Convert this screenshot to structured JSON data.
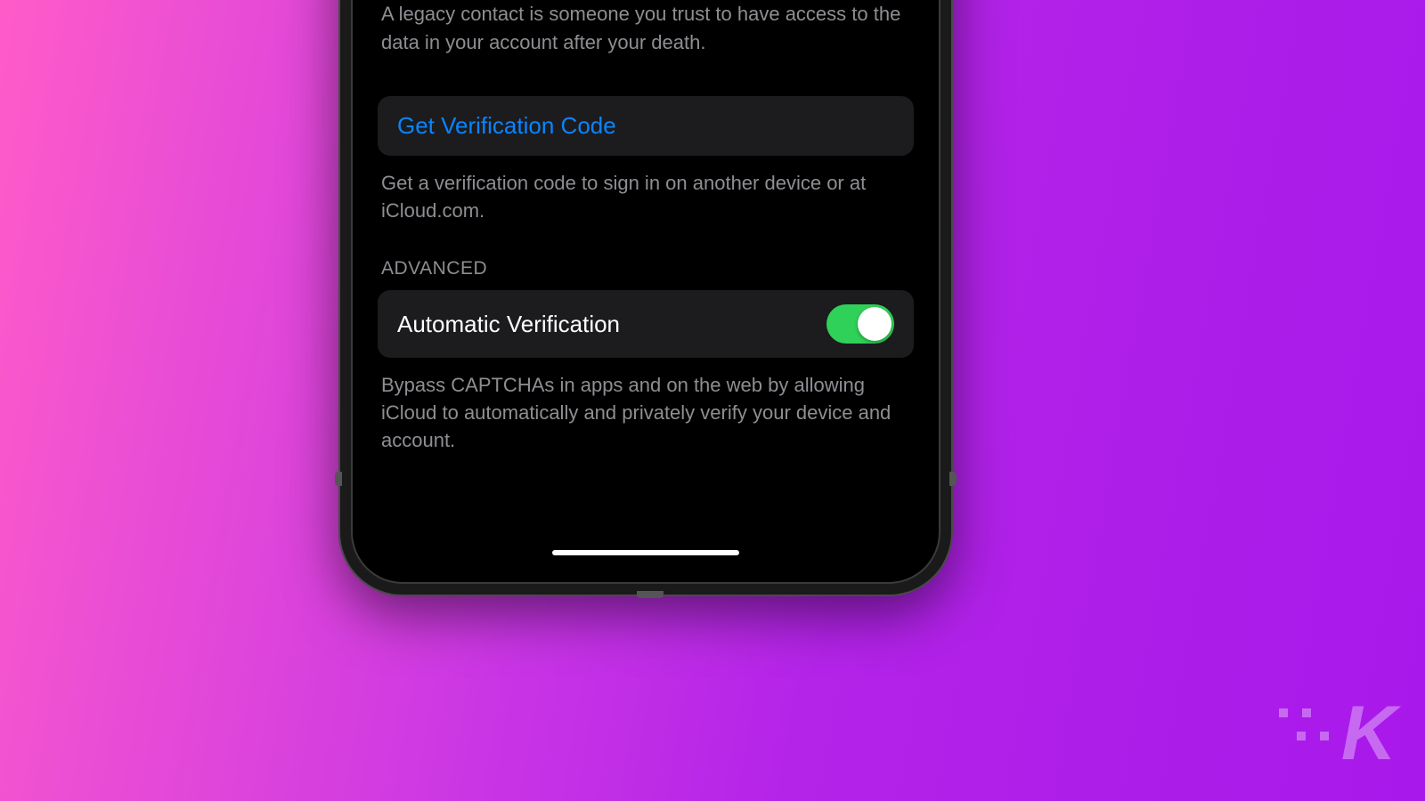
{
  "legacy_contact_footer": "A legacy contact is someone you trust to have access to the data in your account after your death.",
  "verification": {
    "button_label": "Get Verification Code",
    "description": "Get a verification code to sign in on another device or at iCloud.com."
  },
  "advanced": {
    "header": "ADVANCED",
    "automatic_verification": {
      "label": "Automatic Verification",
      "enabled": true,
      "description": "Bypass CAPTCHAs in apps and on the web by allowing iCloud to automatically and privately verify your device and account."
    }
  },
  "watermark": "K"
}
